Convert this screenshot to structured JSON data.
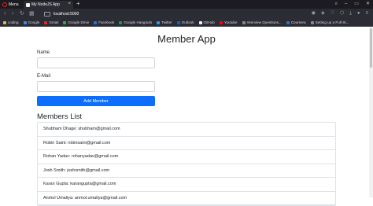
{
  "browser": {
    "menu_label": "Menu",
    "tab_title": "My NodeJS App",
    "tab_close": "×",
    "new_tab": "+",
    "url": "localhost:5000",
    "bookmarks": [
      {
        "label": "coding",
        "color": "#e0b84a"
      },
      {
        "label": "Google",
        "color": "#4285f4"
      },
      {
        "label": "Gmail",
        "color": "#d93025"
      },
      {
        "label": "Google Drive",
        "color": "#34a853"
      },
      {
        "label": "Facebook",
        "color": "#1877f2"
      },
      {
        "label": "Google Hangouts",
        "color": "#0f9d58"
      },
      {
        "label": "Twitter",
        "color": "#1da1f2"
      },
      {
        "label": "Outlook",
        "color": "#0a64d6"
      },
      {
        "label": "GitHub",
        "color": "#f0f0f0"
      },
      {
        "label": "Youtube",
        "color": "#ff0000"
      },
      {
        "label": "Interview Questions...",
        "color": "#888888"
      },
      {
        "label": "Coursera",
        "color": "#2a73cc"
      },
      {
        "label": "Setting up a Full-St...",
        "color": "#888888"
      }
    ]
  },
  "page": {
    "title": "Member App",
    "name_label": "Name",
    "email_label": "E-Mail",
    "name_value": "",
    "email_value": "",
    "add_button": "Add Member",
    "list_title": "Members List",
    "members": [
      "Shubham Dhage: shubham@gmail.com",
      "Robin Saini: robinsaini@gmail.com",
      "Rohan Yadav: rohanyadav@gmail.com",
      "Josh Smith: joshsmith@gmail.com",
      "Karan Gupta: karangupta@gmail.com",
      "Anmol Umaliya: anmol.umaliya@gmail.com"
    ]
  }
}
